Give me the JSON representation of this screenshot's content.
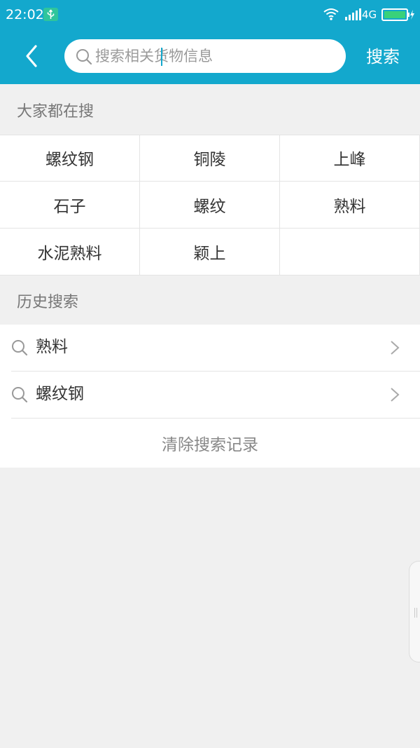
{
  "status_bar": {
    "time": "22:02",
    "network": "4G",
    "icons": [
      "usb-icon",
      "wifi-icon",
      "signal-icon",
      "battery-charging-icon"
    ]
  },
  "header": {
    "back_icon": "chevron-left-icon",
    "search_placeholder": "搜索相关货物信息",
    "search_value": "",
    "search_button": "搜索"
  },
  "hot_searches": {
    "title": "大家都在搜",
    "items": [
      "螺纹钢",
      "铜陵",
      "上峰",
      "石子",
      "螺纹",
      "熟料",
      "水泥熟料",
      "颖上"
    ]
  },
  "history": {
    "title": "历史搜索",
    "items": [
      "熟料",
      "螺纹钢"
    ],
    "clear_label": "清除搜索记录"
  },
  "colors": {
    "accent": "#13a8cd",
    "background": "#f0f0f0",
    "divider": "#e4e4e4"
  }
}
